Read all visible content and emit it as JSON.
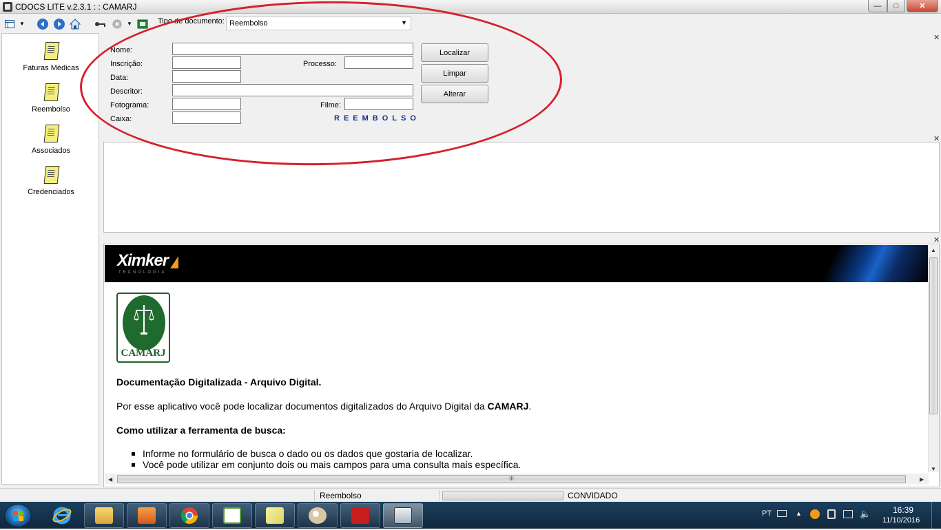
{
  "window": {
    "title": "CDOCS LITE v.2.3.1 : : CAMARJ",
    "minimize_glyph": "—",
    "maximize_glyph": "□",
    "close_glyph": "✕"
  },
  "toolbar": {
    "doc_type_label": "Tipo de documento:",
    "doc_type_value": "Reembolso",
    "icons": [
      "panel-toggle-icon",
      "back-icon",
      "forward-icon",
      "home-icon",
      "key-icon",
      "gear-icon",
      "exit-icon"
    ]
  },
  "sidebar": {
    "items": [
      {
        "label": "Faturas Médicas"
      },
      {
        "label": "Reembolso"
      },
      {
        "label": "Associados"
      },
      {
        "label": "Credenciados"
      }
    ]
  },
  "search_form": {
    "nome_label": "Nome:",
    "inscricao_label": "Inscrição:",
    "processo_label": "Processo:",
    "data_label": "Data:",
    "descritor_label": "Descritor:",
    "fotograma_label": "Fotograma:",
    "filme_label": "Filme:",
    "caixa_label": "Caixa:",
    "doc_banner": "REEMBOLSO",
    "buttons": {
      "localizar": "Localizar",
      "limpar": "Limpar",
      "alterar": "Alterar"
    }
  },
  "browser": {
    "logo_text": "Ximker",
    "logo_tagline": "TECNOLOGIA",
    "org_logo_text": "CAMARJ",
    "heading": "Documentação Digitalizada - Arquivo Digital.",
    "intro_prefix": "Por esse aplicativo você pode localizar documentos digitalizados do Arquivo Digital da ",
    "intro_bold": "CAMARJ",
    "intro_suffix": ".",
    "howto_heading": "Como utilizar a ferramenta de busca:",
    "bullets": [
      "Informe no formulário de busca o dado ou os dados que gostaria de localizar.",
      "Você pode utilizar em conjunto dois ou mais campos para uma consulta mais específica."
    ],
    "hscroll_grip": "III"
  },
  "statusbar": {
    "document": "Reembolso",
    "user": "CONVIDADO"
  },
  "taskbar": {
    "apps": [
      "explorer",
      "internet-explorer",
      "file-manager",
      "media-player",
      "chrome",
      "notepad-plus",
      "sticky-notes",
      "paint",
      "acrobat",
      "cdocs"
    ],
    "tray_lang": "PT",
    "clock_time": "16:39",
    "clock_date": "11/10/2016"
  },
  "colors": {
    "annotation": "#d6202b",
    "banner_text": "#1a2d8c",
    "camarj_green": "#1f6b2e",
    "ximker_orange": "#f29a1b"
  }
}
